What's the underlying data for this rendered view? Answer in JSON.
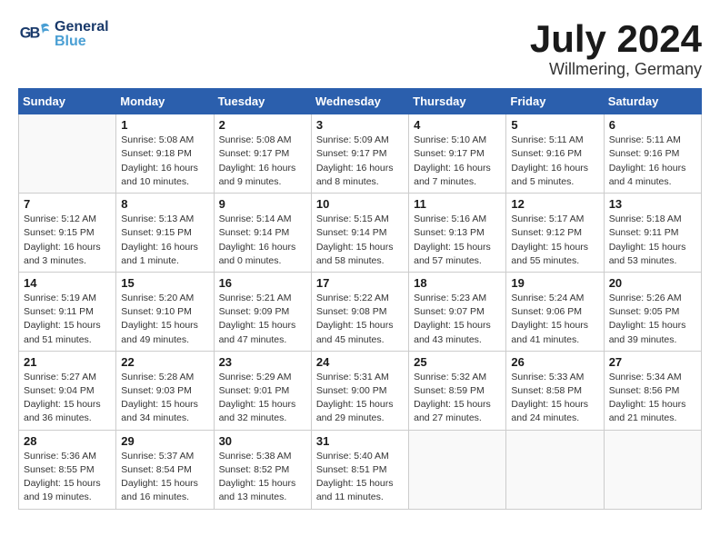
{
  "header": {
    "logo_general": "General",
    "logo_blue": "Blue",
    "month_title": "July 2024",
    "location": "Willmering, Germany"
  },
  "weekdays": [
    "Sunday",
    "Monday",
    "Tuesday",
    "Wednesday",
    "Thursday",
    "Friday",
    "Saturday"
  ],
  "weeks": [
    [
      {
        "day": "",
        "info": ""
      },
      {
        "day": "1",
        "info": "Sunrise: 5:08 AM\nSunset: 9:18 PM\nDaylight: 16 hours\nand 10 minutes."
      },
      {
        "day": "2",
        "info": "Sunrise: 5:08 AM\nSunset: 9:17 PM\nDaylight: 16 hours\nand 9 minutes."
      },
      {
        "day": "3",
        "info": "Sunrise: 5:09 AM\nSunset: 9:17 PM\nDaylight: 16 hours\nand 8 minutes."
      },
      {
        "day": "4",
        "info": "Sunrise: 5:10 AM\nSunset: 9:17 PM\nDaylight: 16 hours\nand 7 minutes."
      },
      {
        "day": "5",
        "info": "Sunrise: 5:11 AM\nSunset: 9:16 PM\nDaylight: 16 hours\nand 5 minutes."
      },
      {
        "day": "6",
        "info": "Sunrise: 5:11 AM\nSunset: 9:16 PM\nDaylight: 16 hours\nand 4 minutes."
      }
    ],
    [
      {
        "day": "7",
        "info": "Sunrise: 5:12 AM\nSunset: 9:15 PM\nDaylight: 16 hours\nand 3 minutes."
      },
      {
        "day": "8",
        "info": "Sunrise: 5:13 AM\nSunset: 9:15 PM\nDaylight: 16 hours\nand 1 minute."
      },
      {
        "day": "9",
        "info": "Sunrise: 5:14 AM\nSunset: 9:14 PM\nDaylight: 16 hours\nand 0 minutes."
      },
      {
        "day": "10",
        "info": "Sunrise: 5:15 AM\nSunset: 9:14 PM\nDaylight: 15 hours\nand 58 minutes."
      },
      {
        "day": "11",
        "info": "Sunrise: 5:16 AM\nSunset: 9:13 PM\nDaylight: 15 hours\nand 57 minutes."
      },
      {
        "day": "12",
        "info": "Sunrise: 5:17 AM\nSunset: 9:12 PM\nDaylight: 15 hours\nand 55 minutes."
      },
      {
        "day": "13",
        "info": "Sunrise: 5:18 AM\nSunset: 9:11 PM\nDaylight: 15 hours\nand 53 minutes."
      }
    ],
    [
      {
        "day": "14",
        "info": "Sunrise: 5:19 AM\nSunset: 9:11 PM\nDaylight: 15 hours\nand 51 minutes."
      },
      {
        "day": "15",
        "info": "Sunrise: 5:20 AM\nSunset: 9:10 PM\nDaylight: 15 hours\nand 49 minutes."
      },
      {
        "day": "16",
        "info": "Sunrise: 5:21 AM\nSunset: 9:09 PM\nDaylight: 15 hours\nand 47 minutes."
      },
      {
        "day": "17",
        "info": "Sunrise: 5:22 AM\nSunset: 9:08 PM\nDaylight: 15 hours\nand 45 minutes."
      },
      {
        "day": "18",
        "info": "Sunrise: 5:23 AM\nSunset: 9:07 PM\nDaylight: 15 hours\nand 43 minutes."
      },
      {
        "day": "19",
        "info": "Sunrise: 5:24 AM\nSunset: 9:06 PM\nDaylight: 15 hours\nand 41 minutes."
      },
      {
        "day": "20",
        "info": "Sunrise: 5:26 AM\nSunset: 9:05 PM\nDaylight: 15 hours\nand 39 minutes."
      }
    ],
    [
      {
        "day": "21",
        "info": "Sunrise: 5:27 AM\nSunset: 9:04 PM\nDaylight: 15 hours\nand 36 minutes."
      },
      {
        "day": "22",
        "info": "Sunrise: 5:28 AM\nSunset: 9:03 PM\nDaylight: 15 hours\nand 34 minutes."
      },
      {
        "day": "23",
        "info": "Sunrise: 5:29 AM\nSunset: 9:01 PM\nDaylight: 15 hours\nand 32 minutes."
      },
      {
        "day": "24",
        "info": "Sunrise: 5:31 AM\nSunset: 9:00 PM\nDaylight: 15 hours\nand 29 minutes."
      },
      {
        "day": "25",
        "info": "Sunrise: 5:32 AM\nSunset: 8:59 PM\nDaylight: 15 hours\nand 27 minutes."
      },
      {
        "day": "26",
        "info": "Sunrise: 5:33 AM\nSunset: 8:58 PM\nDaylight: 15 hours\nand 24 minutes."
      },
      {
        "day": "27",
        "info": "Sunrise: 5:34 AM\nSunset: 8:56 PM\nDaylight: 15 hours\nand 21 minutes."
      }
    ],
    [
      {
        "day": "28",
        "info": "Sunrise: 5:36 AM\nSunset: 8:55 PM\nDaylight: 15 hours\nand 19 minutes."
      },
      {
        "day": "29",
        "info": "Sunrise: 5:37 AM\nSunset: 8:54 PM\nDaylight: 15 hours\nand 16 minutes."
      },
      {
        "day": "30",
        "info": "Sunrise: 5:38 AM\nSunset: 8:52 PM\nDaylight: 15 hours\nand 13 minutes."
      },
      {
        "day": "31",
        "info": "Sunrise: 5:40 AM\nSunset: 8:51 PM\nDaylight: 15 hours\nand 11 minutes."
      },
      {
        "day": "",
        "info": ""
      },
      {
        "day": "",
        "info": ""
      },
      {
        "day": "",
        "info": ""
      }
    ]
  ]
}
